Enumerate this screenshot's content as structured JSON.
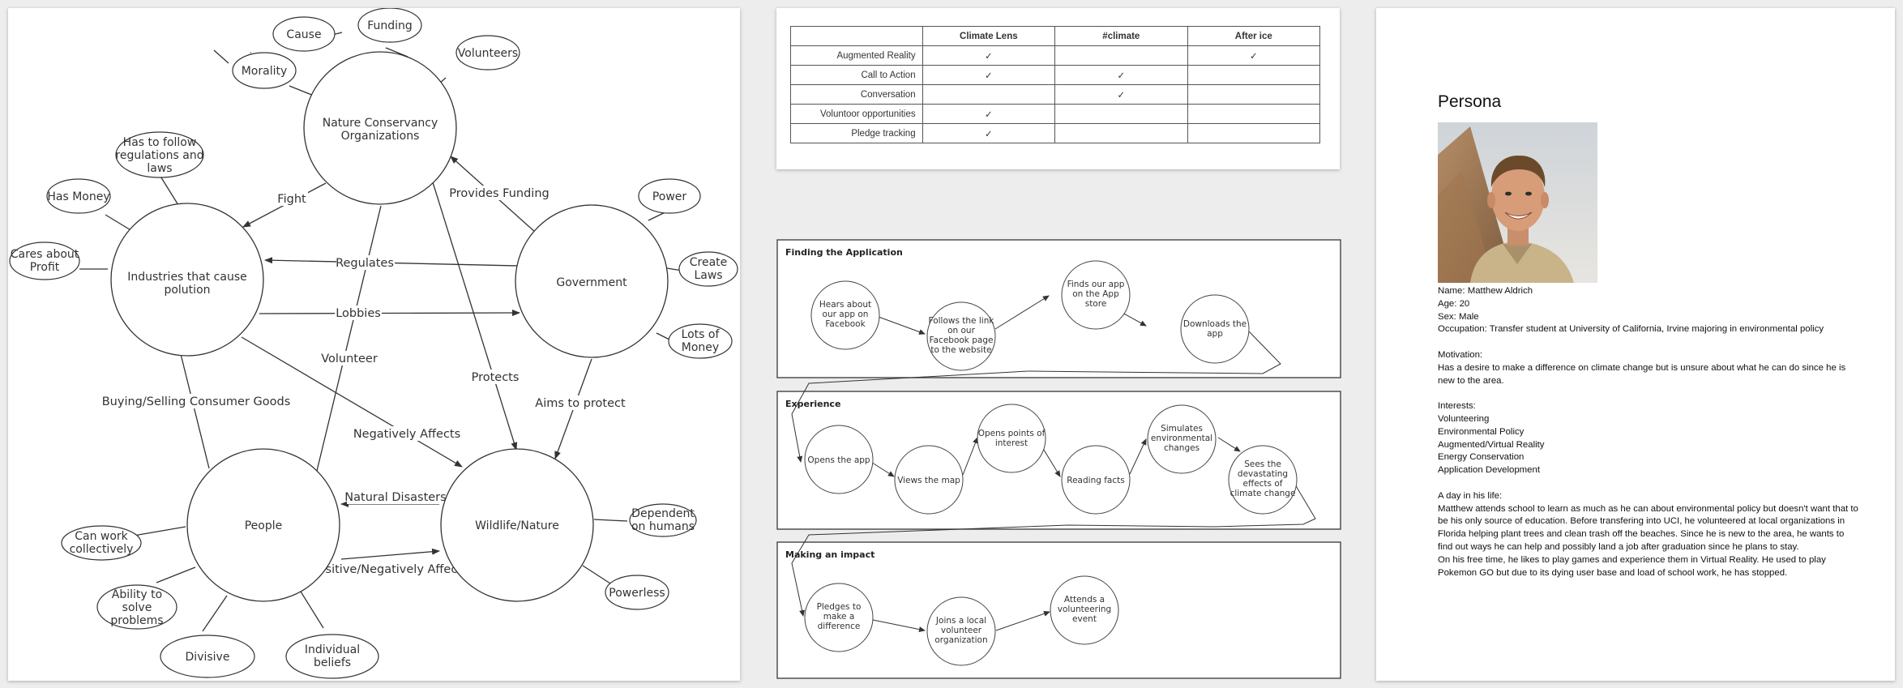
{
  "concept_map": {
    "nodes": {
      "nature": "Nature Conservancy Organizations",
      "industries": "Industries that cause polution",
      "government": "Government",
      "people": "People",
      "wildlife": "Wildlife/Nature"
    },
    "edges": {
      "fight": "Fight",
      "provides_funding": "Provides Funding",
      "regulates": "Regulates",
      "lobbies": "Lobbies",
      "volunteer": "Volunteer",
      "protects": "Protects",
      "aims_to_protect": "Aims to protect",
      "buying_selling": "Buying/Selling Consumer Goods",
      "negatively_affects": "Negatively Affects",
      "natural_disasters": "Natural Disasters",
      "positive_negatively_affects": "Positive/Negatively Affects"
    },
    "attributes": {
      "cause": "Cause",
      "funding": "Funding",
      "morality": "Morality",
      "volunteers": "Volunteers",
      "has_to_follow": "Has to follow regulations and laws",
      "has_money": "Has Money",
      "cares_about_profit": "Cares about Profit",
      "power": "Power",
      "create_laws": "Create Laws",
      "lots_of_money": "Lots of Money",
      "dependent_on_humans": "Dependent on humans",
      "powerless": "Powerless",
      "can_work_collectively": "Can work collectively",
      "ability_to_solve": "Ability to solve problems",
      "divisive": "Divisive",
      "individual_beliefs": "Individual beliefs"
    }
  },
  "comparison": {
    "columns": [
      "",
      "Climate Lens",
      "#climate",
      "After ice"
    ],
    "rows": [
      {
        "feature": "Augmented Reality",
        "values": [
          "✓",
          "",
          "✓"
        ]
      },
      {
        "feature": "Call to Action",
        "values": [
          "✓",
          "✓",
          ""
        ]
      },
      {
        "feature": "Conversation",
        "values": [
          "",
          "✓",
          ""
        ]
      },
      {
        "feature": "Voluntoor opportunities",
        "values": [
          "✓",
          "",
          ""
        ]
      },
      {
        "feature": "Pledge tracking",
        "values": [
          "✓",
          "",
          ""
        ]
      }
    ]
  },
  "journey": {
    "sections": [
      {
        "title": "Finding the Application",
        "steps": [
          "Hears about our app on Facebook",
          "Follows the link on our Facebook page to the website",
          "Finds our app on the App store",
          "Downloads the app"
        ]
      },
      {
        "title": "Experience",
        "steps": [
          "Opens the app",
          "Views the map",
          "Opens points of interest",
          "Reading facts",
          "Simulates environmental changes",
          "Sees the devastating effects of climate change"
        ]
      },
      {
        "title": "Making an impact",
        "steps": [
          "Pledges to make a difference",
          "Joins a local volunteer organization",
          "Attends a volunteering event"
        ]
      }
    ]
  },
  "persona": {
    "title": "Persona",
    "photo_alt": "smiling man in front of pyramid",
    "name": "Name: Matthew Aldrich",
    "age": "Age: 20",
    "sex": "Sex: Male",
    "occupation": "Occupation: Transfer student at University of California, Irvine majoring in environmental policy",
    "motivation_heading": "Motivation:",
    "motivation": "Has a desire to make a difference on climate change but is unsure about what he can do since he is new to the area.",
    "interests_heading": "Interests:",
    "interests": [
      "Volunteering",
      "Environmental Policy",
      "Augmented/Virtual Reality",
      "Energy Conservation",
      "Application Development"
    ],
    "day_heading": "A day in his life:",
    "day_p1": "Matthew attends school to learn as much as he can about environmental policy but doesn't want that to be his only source of education.  Before transfering into UCI, he volunteered at local organizations in Florida helping plant trees and clean trash off the beaches.  Since he is new to the area, he wants to find out ways he can help and possibly land a job after graduation since he plans to stay.",
    "day_p2": "On his free time, he likes to play games and experience them in Virtual Reality.  He used to play Pokemon GO but due to its dying user base and load of school work, he has stopped."
  }
}
